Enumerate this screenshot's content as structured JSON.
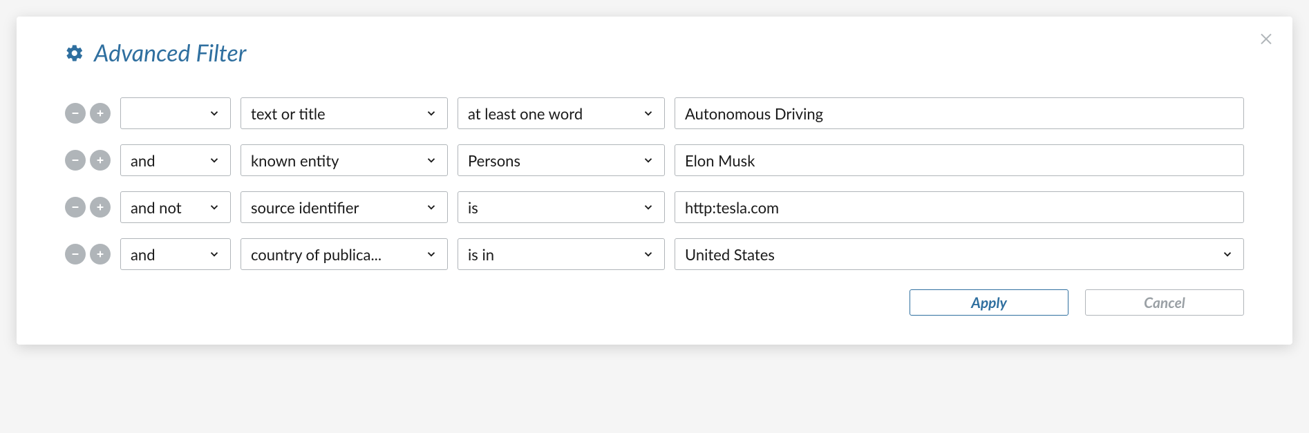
{
  "title": "Advanced Filter",
  "rows": [
    {
      "op": "",
      "field": "text or title",
      "cond": "at least one word",
      "value": "Autonomous Driving",
      "value_is_select": false
    },
    {
      "op": "and",
      "field": "known entity",
      "cond": "Persons",
      "value": "Elon Musk",
      "value_is_select": false
    },
    {
      "op": "and not",
      "field": "source identifier",
      "cond": "is",
      "value": "http:tesla.com",
      "value_is_select": false
    },
    {
      "op": "and",
      "field": "country of publica...",
      "cond": "is in",
      "value": "United States",
      "value_is_select": true
    }
  ],
  "buttons": {
    "apply": "Apply",
    "cancel": "Cancel"
  }
}
